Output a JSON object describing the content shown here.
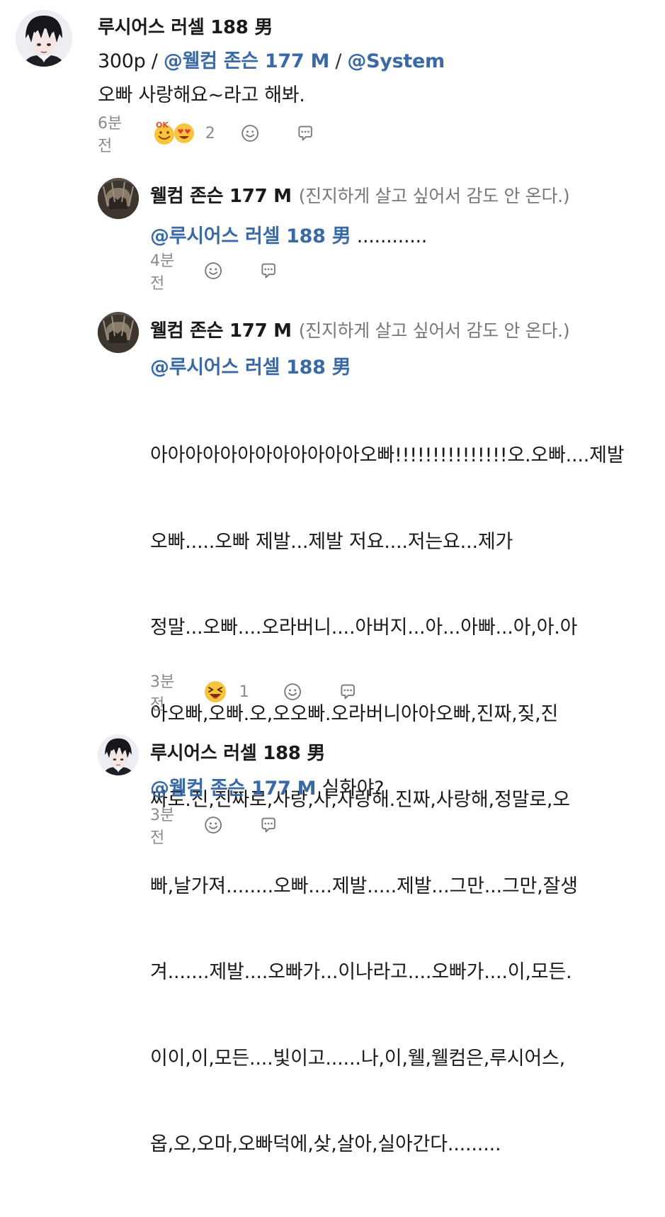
{
  "comments": [
    {
      "author": "루시어스 러셀 188 男",
      "line1": {
        "text": "300p / ",
        "mention1": "@웰컴 존슨 177 M",
        "sep": " / ",
        "mention2": "@System"
      },
      "body": "오빠 사랑해요~라고 해봐.",
      "time": "6분전",
      "reaction_count": "2",
      "reaction_icons": [
        "ok-emoji-icon",
        "heart-eyes-emoji-icon"
      ]
    },
    {
      "author": "웰컴 존슨 177 M",
      "note": "(진지하게 살고 싶어서 감도 안 온다.)",
      "mention": "@루시어스 러셀 188 男",
      "body": " ............",
      "time": "4분전"
    },
    {
      "author": "웰컴 존슨 177 M",
      "note": "(진지하게 살고 싶어서 감도 안 온다.)",
      "mention": "@루시어스 러셀 188 男",
      "body_lines": [
        "아아아아아아아아아아아아오빠!!!!!!!!!!!!!!!오.오빠....제발",
        "오빠.....오빠 제발...제발 저요....저는요...제가",
        "정말...오빠....오라버니....아버지...아...아빠...아,아.아",
        "아오빠,오빠.오,오오빠.오라버니아아오빠,진짜,짖,진",
        "짜로.진,진짜로,사랑,사,사랑해.진짜,사랑해,정말로,오",
        "빠,날가져........오빠....제발.....제발...그만...그만,잘생",
        "겨.......제발....오빠가...이나라고....오빠가....이,모든.",
        "이이,이,모든....빛이고......나,이,웰,웰컴은,루시어스,",
        "옵,오,오마,오빠덕에,샂,살아,실아간다........."
      ],
      "time": "3분전",
      "reaction_count": "1",
      "reaction_icons": [
        "laughing-emoji-icon"
      ]
    },
    {
      "author": "루시어스 러셀 188 男",
      "mention": "@웰컴 존슨 177 M",
      "body": " 실화야?",
      "time": "3분전"
    }
  ],
  "colors": {
    "mention": "#3a6aa6",
    "meta": "#8a8a8a",
    "note": "#777777"
  },
  "icons": [
    "avatar-lucius",
    "avatar-welcome",
    "smiley-react-icon",
    "chat-bubble-reply-icon"
  ]
}
